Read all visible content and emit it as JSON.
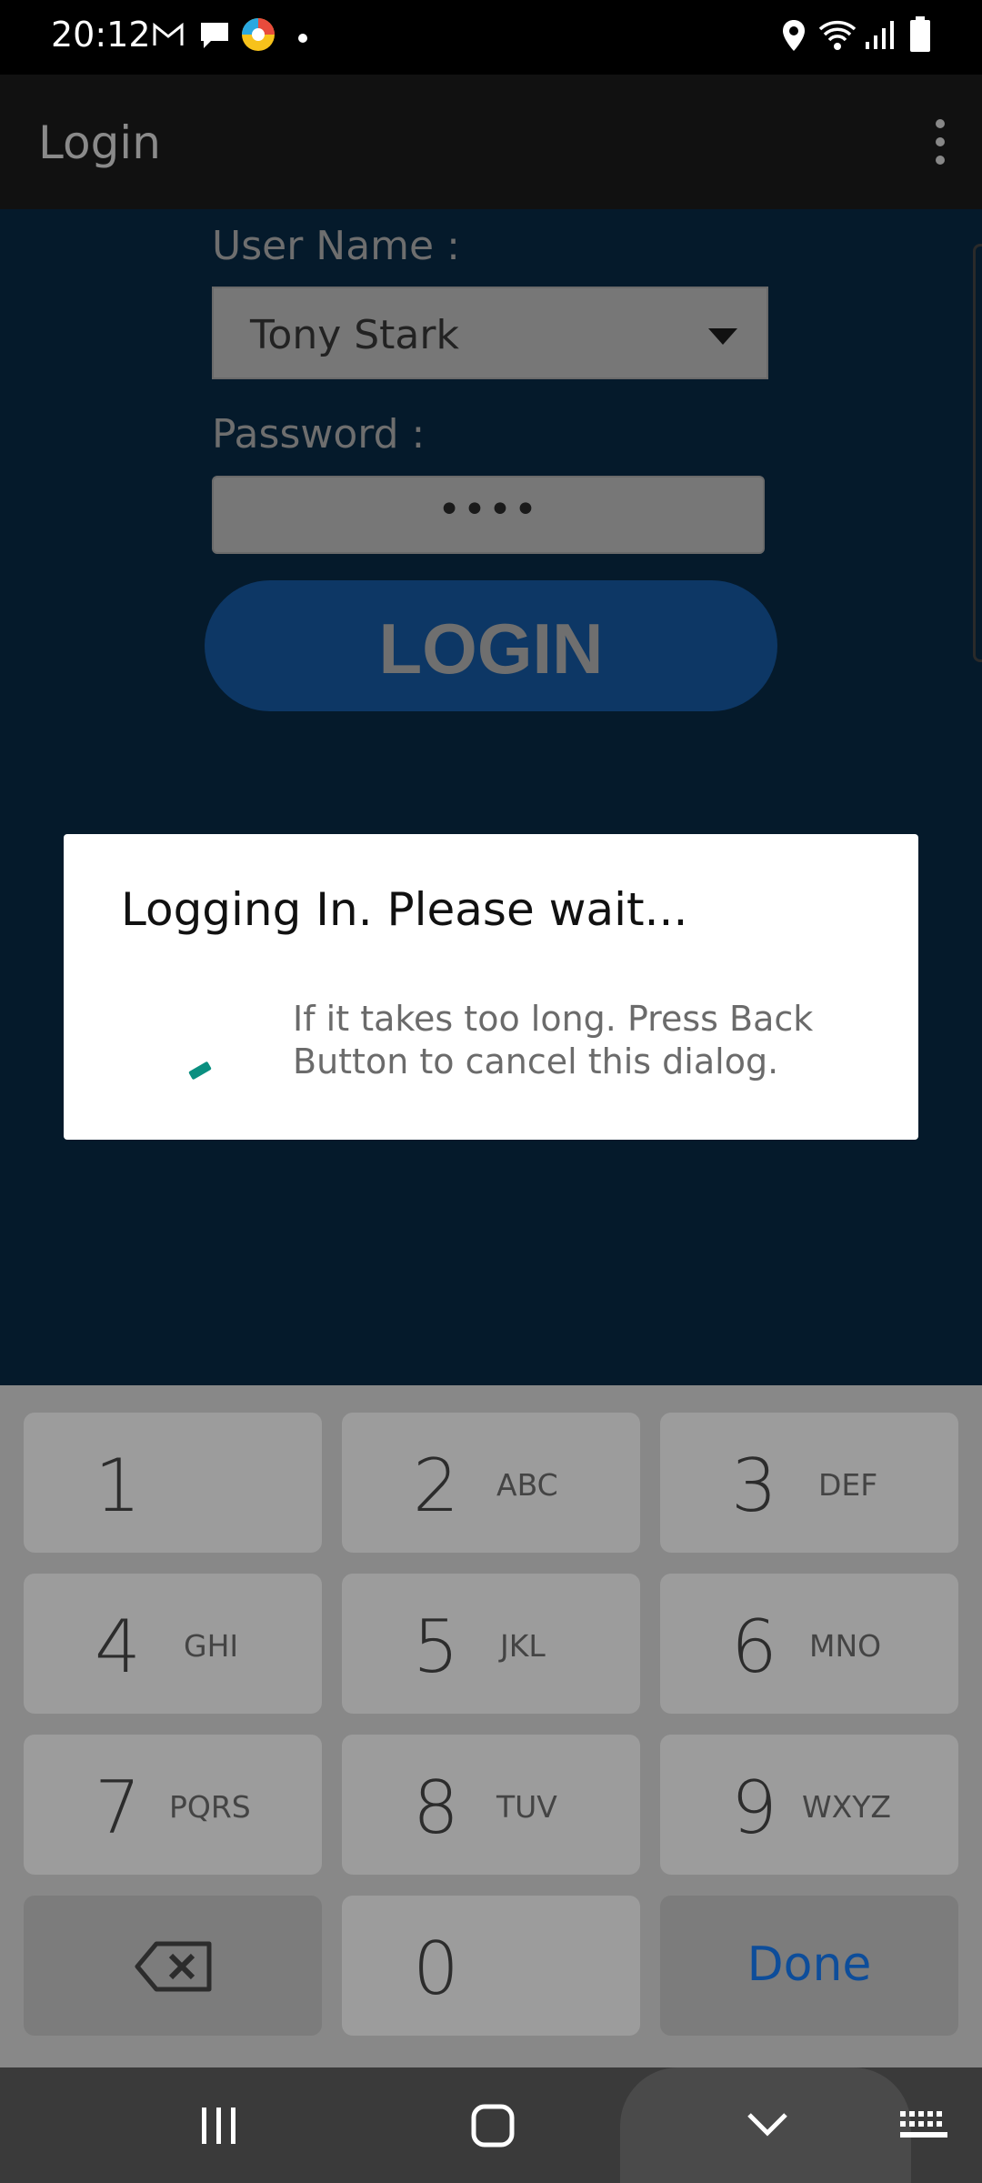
{
  "status_bar": {
    "time": "20:12",
    "icons_left": [
      "gmail-icon",
      "message-icon",
      "app-icon",
      "dot-icon"
    ],
    "icons_right": [
      "location-icon",
      "wifi-icon",
      "signal-icon",
      "battery-icon"
    ]
  },
  "app_bar": {
    "title": "Login"
  },
  "form": {
    "username_label": "User Name :",
    "username_value": "Tony Stark",
    "password_label": "Password :",
    "password_value": "••••",
    "login_button": "LOGIN"
  },
  "dialog": {
    "title": "Logging In. Please wait...",
    "message": "If it takes too long. Press Back Button to cancel this dialog."
  },
  "keyboard": {
    "keys": [
      {
        "digit": "1",
        "letters": ""
      },
      {
        "digit": "2",
        "letters": "ABC"
      },
      {
        "digit": "3",
        "letters": "DEF"
      },
      {
        "digit": "4",
        "letters": "GHI"
      },
      {
        "digit": "5",
        "letters": "JKL"
      },
      {
        "digit": "6",
        "letters": "MNO"
      },
      {
        "digit": "7",
        "letters": "PQRS"
      },
      {
        "digit": "8",
        "letters": "TUV"
      },
      {
        "digit": "9",
        "letters": "WXYZ"
      },
      {
        "digit": "0",
        "letters": ""
      }
    ],
    "done_label": "Done"
  },
  "colors": {
    "content_bg": "#051a2b",
    "login_button": "#0d3765",
    "spinner": "#0a8f80",
    "done_text": "#0d4d9a"
  }
}
